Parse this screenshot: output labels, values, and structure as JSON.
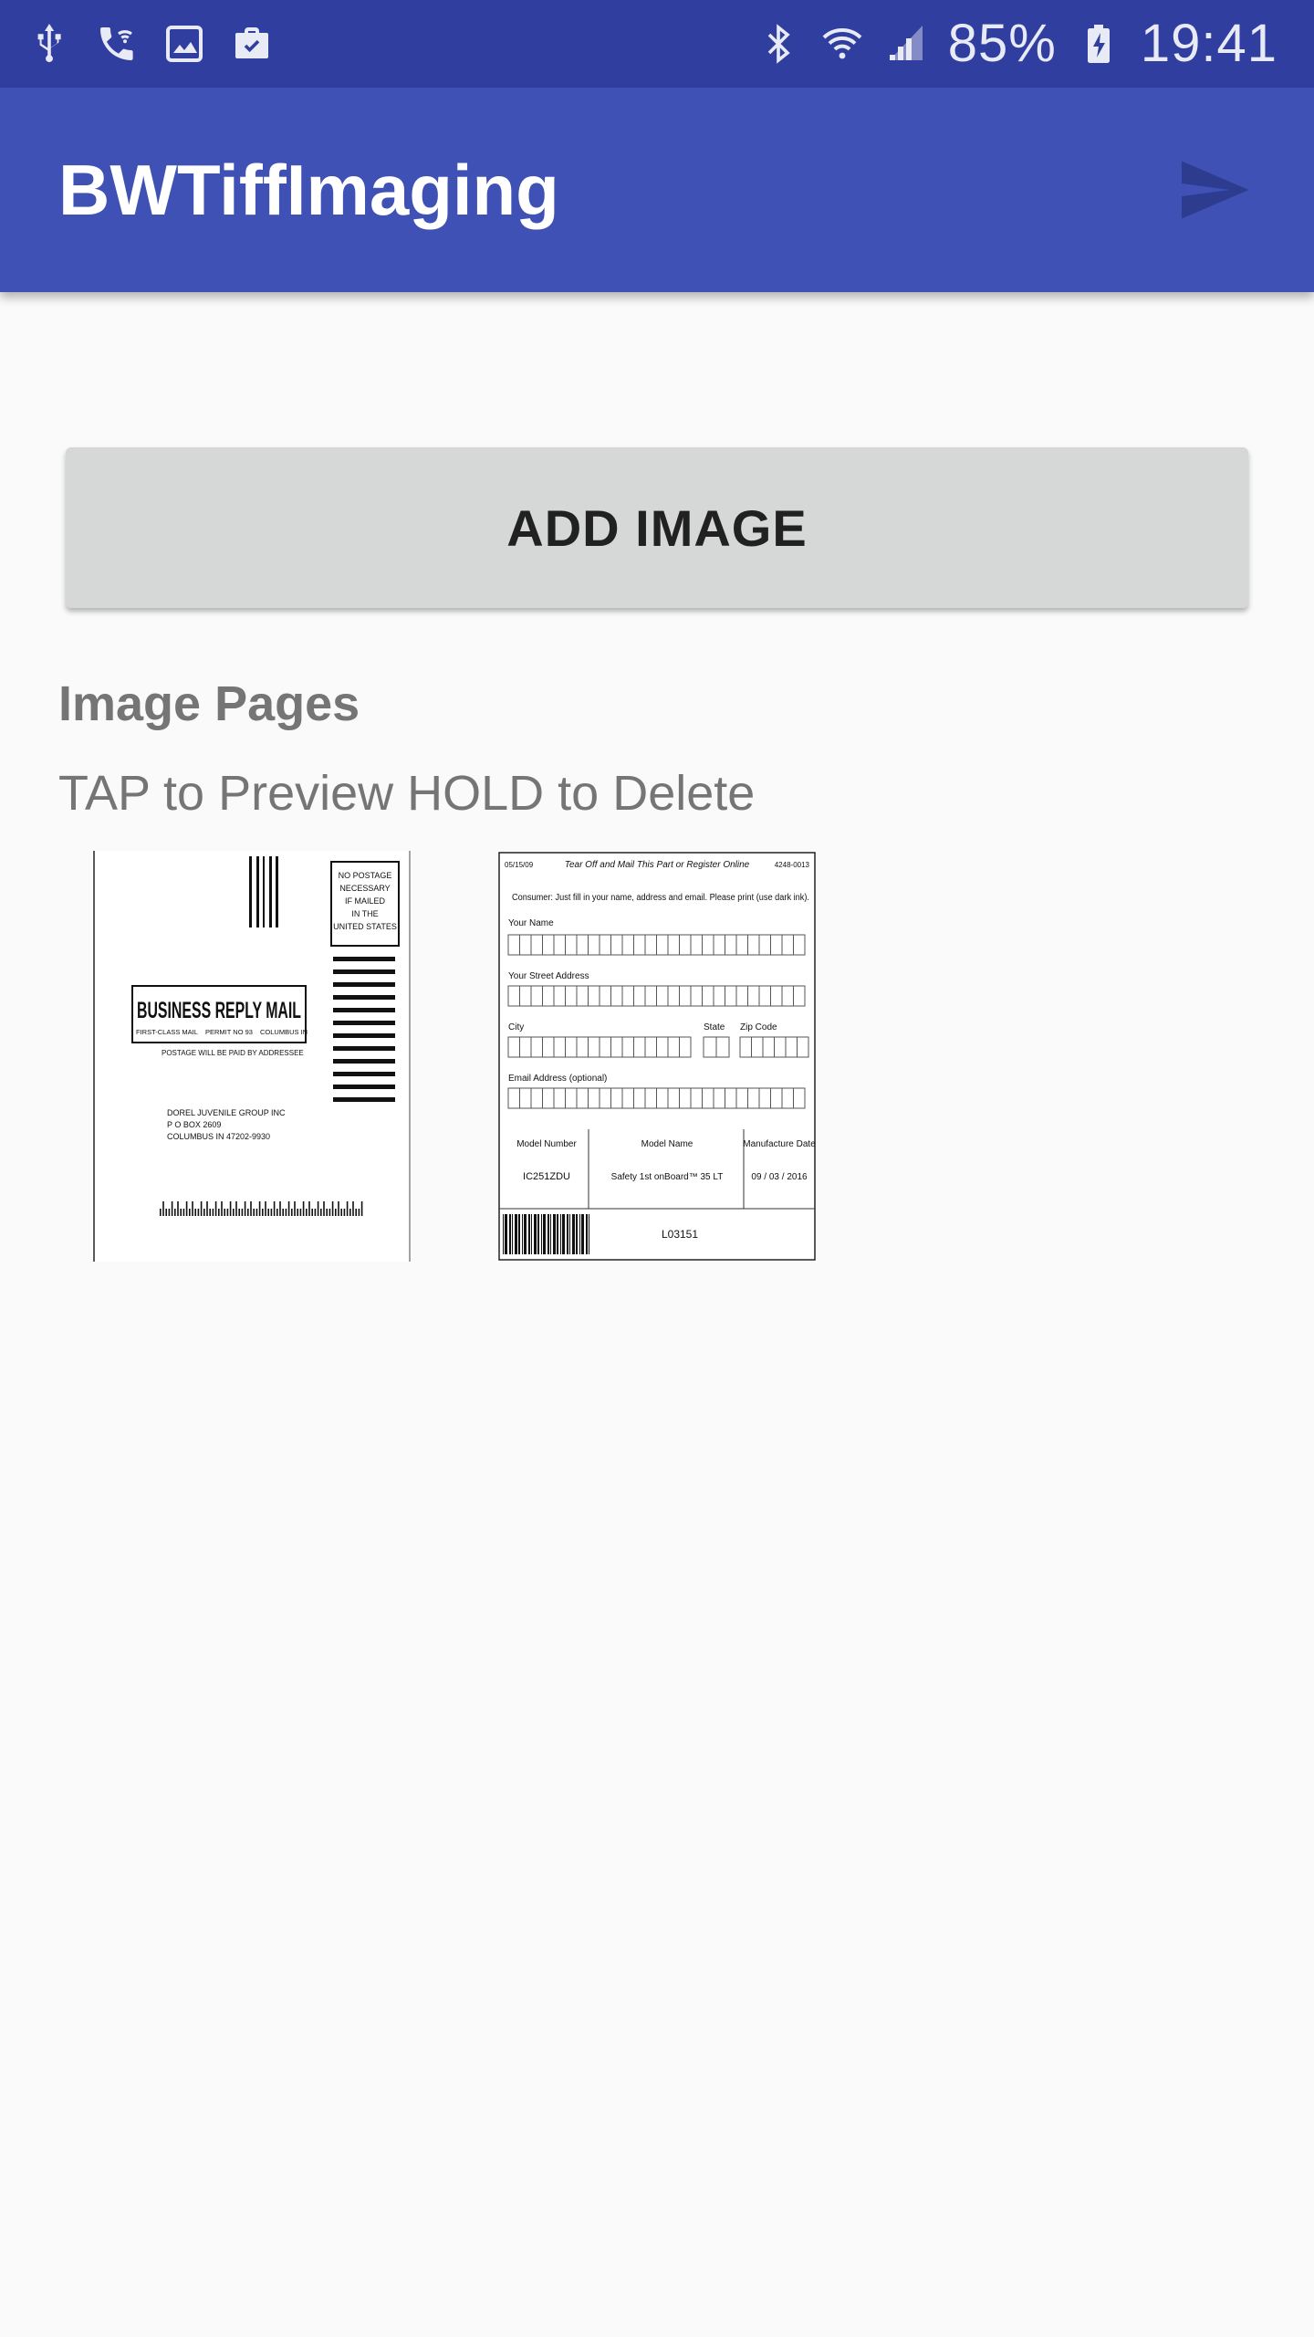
{
  "status_bar": {
    "battery": "85%",
    "time": "19:41",
    "icons_left": [
      "usb-icon",
      "wifi-call-icon",
      "image-icon",
      "briefcase-icon"
    ],
    "icons_right": [
      "bluetooth-icon",
      "wifi-icon",
      "signal-icon",
      "battery-charging-icon"
    ]
  },
  "app_bar": {
    "title": "BWTiffImaging",
    "action_icon": "send-icon"
  },
  "main": {
    "add_button_label": "ADD IMAGE",
    "section_title": "Image Pages",
    "hint": "TAP to Preview HOLD to Delete"
  },
  "thumbnails": [
    {
      "name": "business-reply-mail",
      "postage_box": [
        "NO POSTAGE",
        "NECESSARY",
        "IF MAILED",
        "IN THE",
        "UNITED STATES"
      ],
      "headline": "BUSINESS REPLY MAIL",
      "subline_left": "FIRST-CLASS MAIL",
      "subline_mid": "PERMIT NO 93",
      "subline_right": "COLUMBUS IN",
      "postage_note": "POSTAGE WILL BE PAID BY ADDRESSEE",
      "address": [
        "DOREL JUVENILE GROUP INC",
        "P O BOX 2609",
        "COLUMBUS IN 47202-9930"
      ]
    },
    {
      "name": "registration-form",
      "header_left": "05/15/09",
      "header_center": "Tear Off and Mail This Part or Register Online",
      "header_right": "4248-0013",
      "instructions": "Consumer: Just fill in your name, address and email. Please print (use dark ink).",
      "field_name": "Your Name",
      "field_street": "Your Street Address",
      "field_city": "City",
      "field_state": "State",
      "field_zip": "Zip Code",
      "field_email": "Email Address (optional)",
      "col_model_number": "Model Number",
      "col_model_name": "Model Name",
      "col_manufacture_date": "Manufacture Date",
      "val_model_number": "IC251ZDU",
      "val_model_name": "Safety 1st onBoard™ 35 LT",
      "val_manufacture_date": "09 / 03 / 2016",
      "footer_code": "L03151"
    }
  ]
}
